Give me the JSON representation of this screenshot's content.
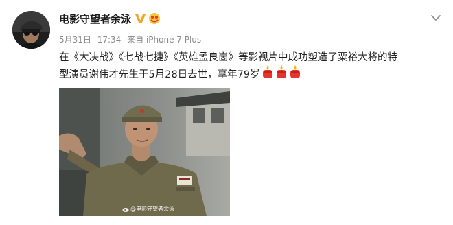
{
  "post": {
    "author": "电影守望者余泳",
    "date": "5月31日",
    "time": "17:34",
    "source": "来自 iPhone 7 Plus",
    "text_line1": "在《大决战》《七战七捷》《英雄孟良崮》等影视片中成功塑造了粟裕大将的特",
    "text_line2": "型演员谢伟才先生于5月28日去世，享年79岁",
    "watermark": "@电影守望者余泳"
  },
  "icons": {
    "verified": "verified-v-icon",
    "member": "member-badge-icon",
    "expand": "chevron-down-icon",
    "emoji": "candle-lantern-emoji",
    "weibo": "weibo-logo-icon"
  },
  "colors": {
    "verified_badge": "#f5a623",
    "lantern_red": "#e8322d",
    "flame_yellow": "#ffb400",
    "meta_gray": "#8a8a8a"
  }
}
